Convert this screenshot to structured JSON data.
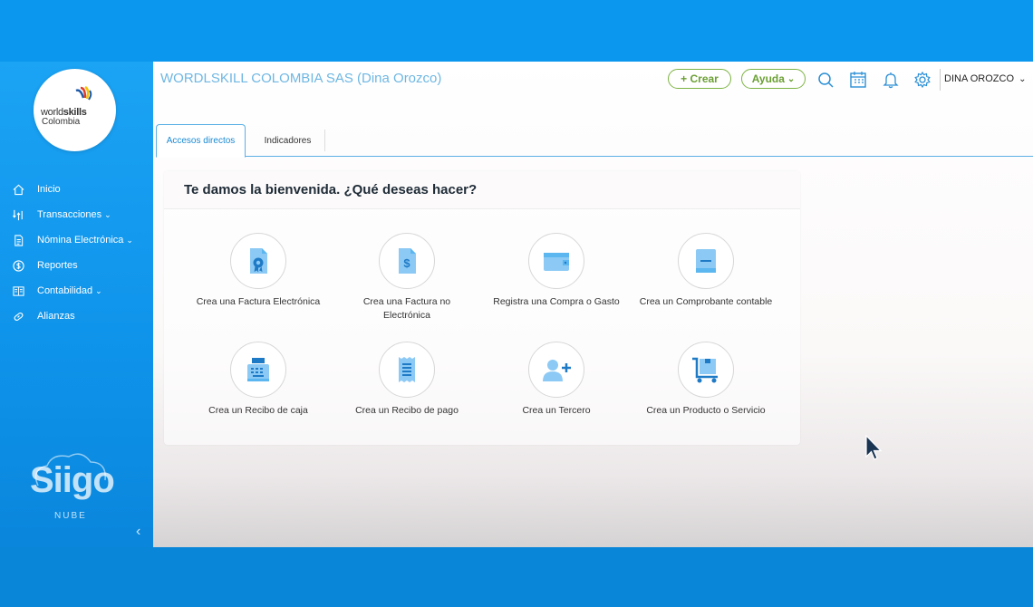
{
  "header": {
    "company": "WORDLSKILL COLOMBIA SAS (Dina Orozco)",
    "crear_label": "+ Crear",
    "ayuda_label": "Ayuda",
    "user_name": "DINA OROZCO"
  },
  "logo": {
    "line1_light": "world",
    "line1_bold": "skills",
    "line2": "Colombia"
  },
  "sidebar": {
    "items": [
      {
        "label": "Inicio",
        "icon": "home-icon"
      },
      {
        "label": "Transacciones",
        "icon": "transactions-icon",
        "has_dropdown": true
      },
      {
        "label": "Nómina Electrónica",
        "icon": "document-icon",
        "has_dropdown": true
      },
      {
        "label": "Reportes",
        "icon": "dollar-icon"
      },
      {
        "label": "Contabilidad",
        "icon": "ledger-icon",
        "has_dropdown": true
      },
      {
        "label": "Alianzas",
        "icon": "link-icon"
      }
    ],
    "brand": "Siigo",
    "brand_sub": "NUBE",
    "collapse": "‹"
  },
  "tabs": [
    {
      "label": "Accesos directos",
      "active": true
    },
    {
      "label": "Indicadores",
      "active": false
    }
  ],
  "welcome": {
    "title": "Te damos la bienvenida. ¿Qué deseas hacer?",
    "tiles": [
      {
        "label": "Crea una Factura Electrónica",
        "icon": "electronic-invoice-icon"
      },
      {
        "label": "Crea una Factura no Electrónica",
        "icon": "invoice-icon"
      },
      {
        "label": "Registra una Compra o Gasto",
        "icon": "wallet-icon"
      },
      {
        "label": "Crea un Comprobante contable",
        "icon": "book-icon"
      },
      {
        "label": "Crea un Recibo de caja",
        "icon": "cash-register-icon"
      },
      {
        "label": "Crea un Recibo de pago",
        "icon": "receipt-icon"
      },
      {
        "label": "Crea un Tercero",
        "icon": "add-person-icon"
      },
      {
        "label": "Crea un Producto o Servicio",
        "icon": "cart-icon"
      }
    ]
  },
  "colors": {
    "brand_blue": "#0b97ee",
    "accent_green": "#7cb342",
    "icon_blue": "#5cb6f0",
    "icon_dark": "#1f7ac6"
  }
}
